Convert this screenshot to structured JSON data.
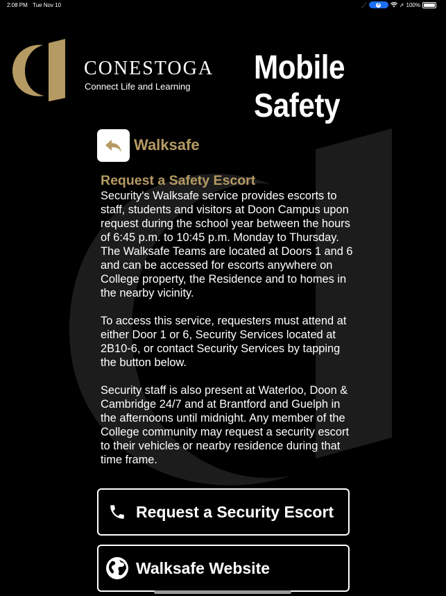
{
  "status_bar": {
    "time": "2:08 PM",
    "date": "Tue Nov 10",
    "battery": "100%"
  },
  "header": {
    "brand_name": "CONESTOGA",
    "brand_tagline": "Connect Life and Learning",
    "app_title": "Mobile Safety"
  },
  "page": {
    "title": "Walksafe"
  },
  "content": {
    "heading": "Request a Safety Escort",
    "paragraphs": [
      "Security's Walksafe service provides escorts to staff, students and visitors at Doon Campus upon request during the school year between the hours of 6:45 p.m. to 10:45 p.m. Monday to Thursday. The Walksafe Teams are located at Doors 1 and 6 and can be accessed for escorts anywhere on College property, the Residence and to homes in the nearby vicinity.",
      "To access this service, requesters must attend at either Door 1 or 6, Security Services located at 2B10-6, or contact Security Services by tapping the button below.",
      "Security staff is also present at Waterloo, Doon & Cambridge 24/7 and at Brantford and Guelph in the afternoons until midnight. Any member of the College community may request a security escort to their vehicles or nearby residence during that time frame."
    ]
  },
  "buttons": {
    "request_escort": {
      "label": "Request a Security Escort",
      "icon": "phone-icon"
    },
    "website": {
      "label": "Walksafe Website",
      "icon": "globe-icon"
    }
  },
  "colors": {
    "accent": "#b59a63",
    "background": "#000000",
    "text": "#ffffff"
  }
}
